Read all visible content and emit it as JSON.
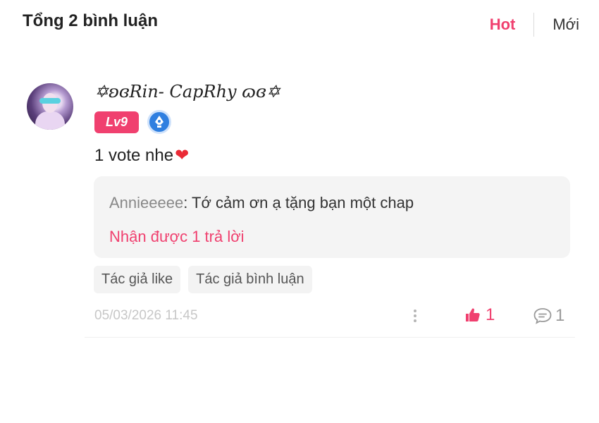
{
  "header": {
    "title": "Tổng 2 bình luận",
    "sort_hot": "Hot",
    "sort_new": "Mới"
  },
  "comment": {
    "username": "✡ʚɞRin- CapRhy ɷɞ✡",
    "level": "Lv9",
    "text": "1 vote nhe",
    "reply_preview": {
      "author": "Annieeeee",
      "separator": ": ",
      "text": "Tớ cảm ơn ạ tặng bạn một chap"
    },
    "reply_count_label": "Nhận được 1 trả lời",
    "tags": [
      "Tác giả like",
      "Tác giả bình luận"
    ],
    "timestamp": "05/03/2026 11:45",
    "likes": "1",
    "replies": "1"
  },
  "colors": {
    "accent": "#f0406f",
    "verify": "#2f7fe0",
    "heart": "#ea2a36"
  },
  "icons": [
    "heart-emoji",
    "verified-pen-icon",
    "more-vertical-icon",
    "thumbs-up-icon",
    "comment-icon"
  ]
}
